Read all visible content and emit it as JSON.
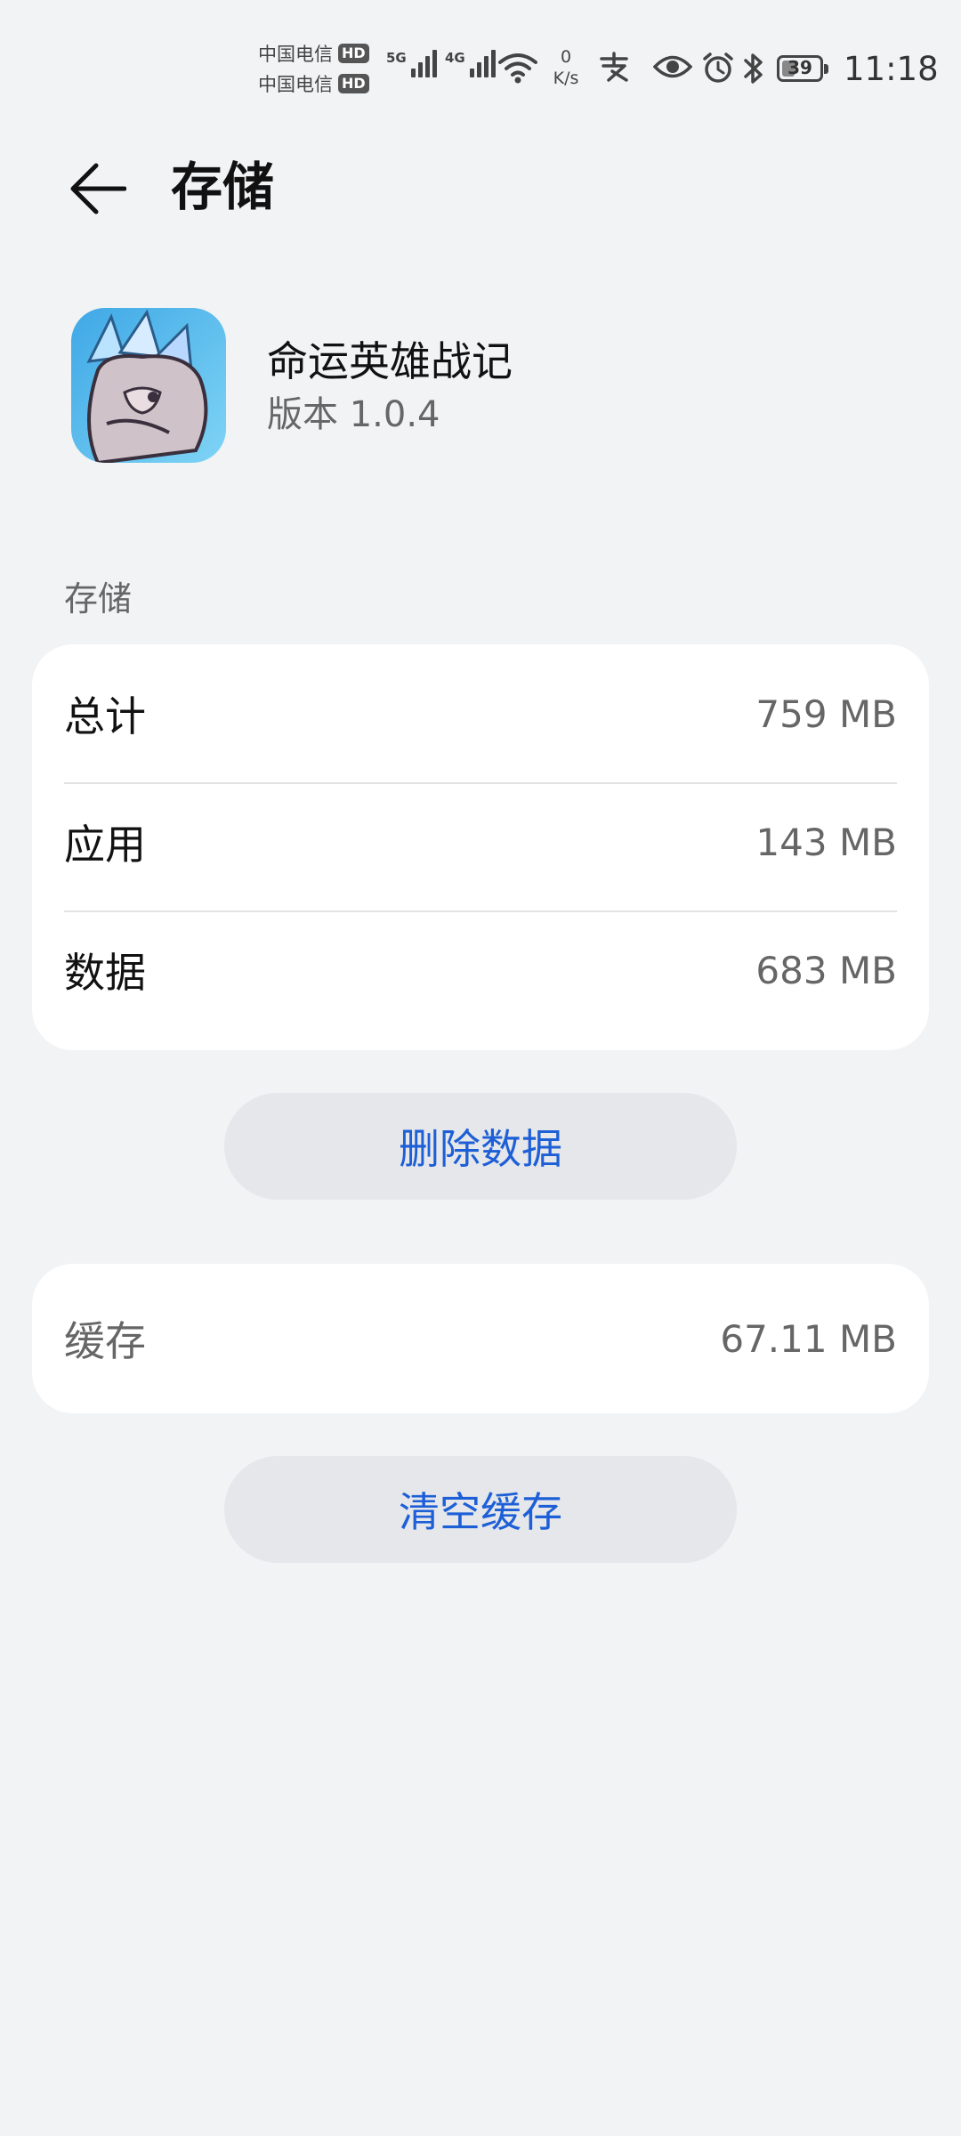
{
  "status_bar": {
    "carriers": [
      "中国电信",
      "中国电信"
    ],
    "hd_badge": "HD",
    "signal_5g": "5G",
    "signal_4g": "4G",
    "net_speed_value": "0",
    "net_speed_unit": "K/s",
    "battery": "39",
    "time": "11:18"
  },
  "header": {
    "title": "存储"
  },
  "app": {
    "name": "命运英雄战记",
    "version": "版本 1.0.4"
  },
  "storage": {
    "section_label": "存储",
    "rows": [
      {
        "label": "总计",
        "value": "759 MB"
      },
      {
        "label": "应用",
        "value": "143 MB"
      },
      {
        "label": "数据",
        "value": "683 MB"
      }
    ],
    "delete_button": "删除数据"
  },
  "cache": {
    "label": "缓存",
    "value": "67.11 MB",
    "clear_button": "清空缓存"
  },
  "colors": {
    "accent": "#1d5fd6",
    "background": "#f1f3f5",
    "card": "#ffffff"
  }
}
